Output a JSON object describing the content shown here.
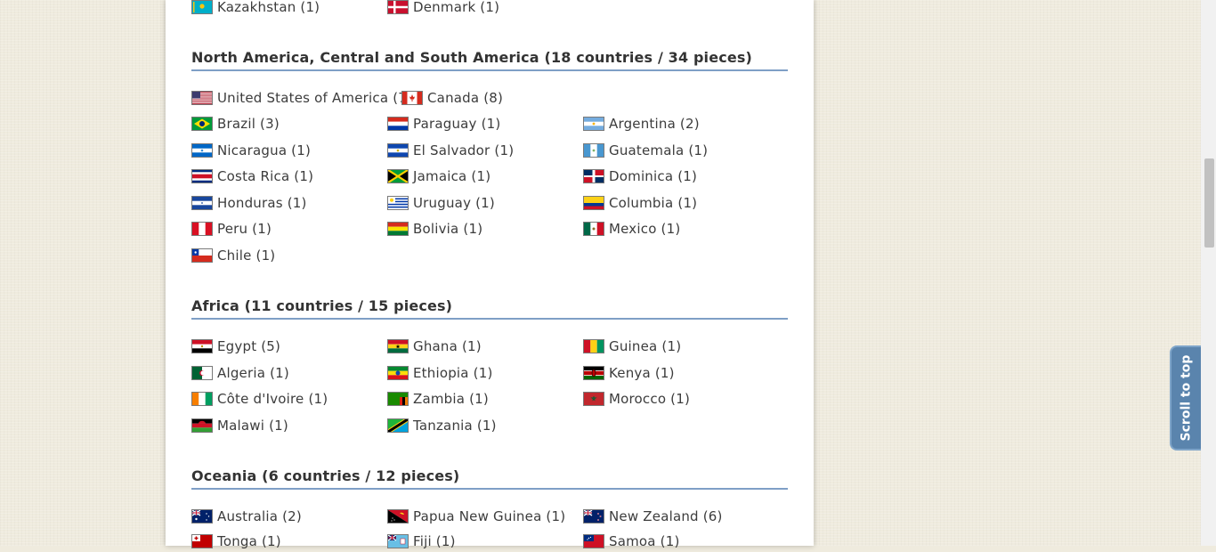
{
  "continents": [
    {
      "heading": "",
      "items": [
        {
          "label": "Kazakhstan (1)",
          "flag": "kazakhstan-flag-icon"
        },
        {
          "label": "Denmark (1)",
          "flag": "denmark-flag-icon"
        }
      ]
    },
    {
      "heading": "North America, Central and South America (18 countries / 34 pieces)",
      "items": [
        {
          "label": "United States of America (7)",
          "flag": "usa-flag-icon"
        },
        {
          "label": "Canada (8)",
          "flag": "canada-flag-icon"
        },
        {
          "label": "Brazil (3)",
          "flag": "brazil-flag-icon"
        },
        {
          "label": "Paraguay (1)",
          "flag": "paraguay-flag-icon"
        },
        {
          "label": "Argentina (2)",
          "flag": "argentina-flag-icon"
        },
        {
          "label": "Nicaragua (1)",
          "flag": "nicaragua-flag-icon"
        },
        {
          "label": "El Salvador (1)",
          "flag": "el-salvador-flag-icon"
        },
        {
          "label": "Guatemala (1)",
          "flag": "guatemala-flag-icon"
        },
        {
          "label": "Costa Rica (1)",
          "flag": "costa-rica-flag-icon"
        },
        {
          "label": "Jamaica (1)",
          "flag": "jamaica-flag-icon"
        },
        {
          "label": "Dominica (1)",
          "flag": "dominican-flag-icon"
        },
        {
          "label": "Honduras (1)",
          "flag": "honduras-flag-icon"
        },
        {
          "label": "Uruguay (1)",
          "flag": "uruguay-flag-icon"
        },
        {
          "label": "Columbia (1)",
          "flag": "colombia-flag-icon"
        },
        {
          "label": "Peru (1)",
          "flag": "peru-flag-icon"
        },
        {
          "label": "Bolivia (1)",
          "flag": "bolivia-flag-icon"
        },
        {
          "label": "Mexico (1)",
          "flag": "mexico-flag-icon"
        },
        {
          "label": "Chile (1)",
          "flag": "chile-flag-icon"
        }
      ]
    },
    {
      "heading": "Africa (11 countries / 15 pieces)",
      "items": [
        {
          "label": "Egypt (5)",
          "flag": "egypt-flag-icon"
        },
        {
          "label": "Ghana (1)",
          "flag": "ghana-flag-icon"
        },
        {
          "label": "Guinea (1)",
          "flag": "guinea-flag-icon"
        },
        {
          "label": "Algeria (1)",
          "flag": "algeria-flag-icon"
        },
        {
          "label": "Ethiopia (1)",
          "flag": "ethiopia-flag-icon"
        },
        {
          "label": "Kenya (1)",
          "flag": "kenya-flag-icon"
        },
        {
          "label": "Côte d'Ivoire (1)",
          "flag": "cote-divoire-flag-icon"
        },
        {
          "label": "Zambia (1)",
          "flag": "zambia-flag-icon"
        },
        {
          "label": "Morocco (1)",
          "flag": "morocco-flag-icon"
        },
        {
          "label": "Malawi (1)",
          "flag": "malawi-flag-icon"
        },
        {
          "label": "Tanzania (1)",
          "flag": "tanzania-flag-icon"
        }
      ]
    },
    {
      "heading": "Oceania (6 countries / 12 pieces)",
      "items": [
        {
          "label": "Australia (2)",
          "flag": "australia-flag-icon"
        },
        {
          "label": "Papua New Guinea (1)",
          "flag": "papua-new-guinea-flag-icon"
        },
        {
          "label": "New Zealand (6)",
          "flag": "new-zealand-flag-icon"
        },
        {
          "label": "Tonga (1)",
          "flag": "tonga-flag-icon"
        },
        {
          "label": "Fiji (1)",
          "flag": "fiji-flag-icon"
        },
        {
          "label": "Samoa (1)",
          "flag": "samoa-flag-icon"
        }
      ]
    }
  ],
  "scroll_to_top": "Scroll to top",
  "colors": {
    "page_background": "#efebde",
    "panel_background": "#ffffff",
    "heading_rule": "#7f9fc6",
    "scroll_button": "#5a84ad"
  }
}
